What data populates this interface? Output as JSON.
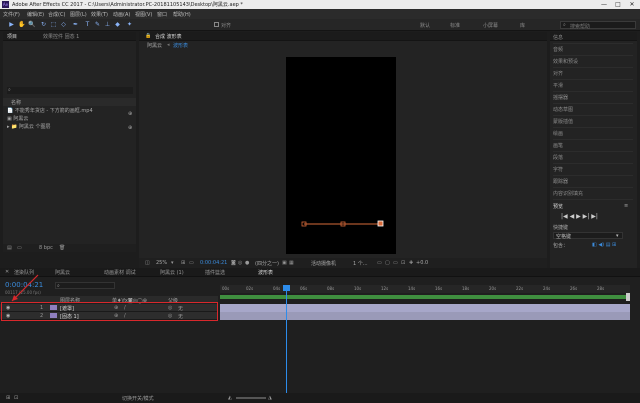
{
  "window": {
    "title": "Adobe After Effects CC 2017 - C:\\Users\\Administrator.PC-20181105143\\Desktop\\阿黑云.aep *",
    "minimize": "—",
    "maximize": "□",
    "close": "✕"
  },
  "menu": [
    "文件(F)",
    "编辑(E)",
    "合成(C)",
    "图层(L)",
    "效果(T)",
    "动画(A)",
    "视图(V)",
    "窗口",
    "帮助(H)"
  ],
  "toolbar": {
    "tools": [
      "▶",
      "✋",
      "🔍",
      "↻",
      "⬚",
      "◇",
      "✒",
      "T",
      "✎",
      "⊥",
      "◆",
      "✦"
    ],
    "align_label": "对齐",
    "workspaces": [
      "默认",
      "标准",
      "小屏幕",
      "库"
    ],
    "search_placeholder": "搜索帮助"
  },
  "project_panel": {
    "tab_project": "项目",
    "tab_effects": "效果控件 固态 1",
    "search_placeholder": "",
    "column_name": "名称",
    "items": [
      {
        "icon": "📄",
        "name": "不能秀年货店 - 下方箭的画框.mp4"
      },
      {
        "icon": "▣",
        "name": "阿黑云"
      },
      {
        "icon": "▸ 📁",
        "name": "阿黑云 个图层"
      }
    ],
    "bottom_bpc": "8 bpc"
  },
  "composition_panel": {
    "tab": "合成 波形表",
    "breadcrumb_1": "阿黑云",
    "breadcrumb_2": "波形表",
    "zoom": "25%",
    "timecode": "0:00:04:21",
    "resolution": "(四分之一)",
    "camera": "活动摄像机",
    "views": "1 个...",
    "exposure": "+0.0"
  },
  "right_panel": {
    "items": [
      "信息",
      "音频",
      "效果和预设",
      "对齐",
      "平滑",
      "摇摆器",
      "动态草图",
      "蒙版插值",
      "绘画",
      "画笔",
      "段落",
      "字符",
      "跟踪器",
      "内容识别填充"
    ],
    "preview_label": "预览",
    "lib_label": "库",
    "controls": [
      "|◀",
      "◀",
      "▶",
      "▶|",
      "▶|"
    ],
    "shortcut_label": "快捷键",
    "shortcut_value": "空格键",
    "include_label": "包含：",
    "icons": [
      "◧",
      "◀)",
      "▤",
      "⊞"
    ]
  },
  "timeline": {
    "tabs": [
      {
        "label": "渲染队列"
      },
      {
        "label": "阿黑云"
      },
      {
        "label": "动画素材 调试"
      },
      {
        "label": "阿黑云 (1)"
      },
      {
        "label": "插件篮选"
      },
      {
        "label": "波形表"
      }
    ],
    "timecode": "0:00:04:21",
    "fps": "00117 (25.00 fps)",
    "column_headers": [
      "图层名称",
      "单♦\\fx◙◎◯⊕",
      "父级"
    ],
    "layers": [
      {
        "num": "1",
        "name": "[遮罩]",
        "parent": "无"
      },
      {
        "num": "2",
        "name": "[固态 1]",
        "parent": "无"
      }
    ],
    "ruler": [
      "00s",
      "02s",
      "04s",
      "06s",
      "08s",
      "10s",
      "12s",
      "14s",
      "16s",
      "18s",
      "20s",
      "22s",
      "24s",
      "26s",
      "28s"
    ],
    "toggle_label": "切换开关/模式"
  },
  "colors": {
    "accent_blue": "#2d8ceb",
    "highlight_red": "#d8282c",
    "work_area": "#3f8f3f",
    "layer_bar": "#a7a7c9",
    "path": "#d96b3a"
  }
}
